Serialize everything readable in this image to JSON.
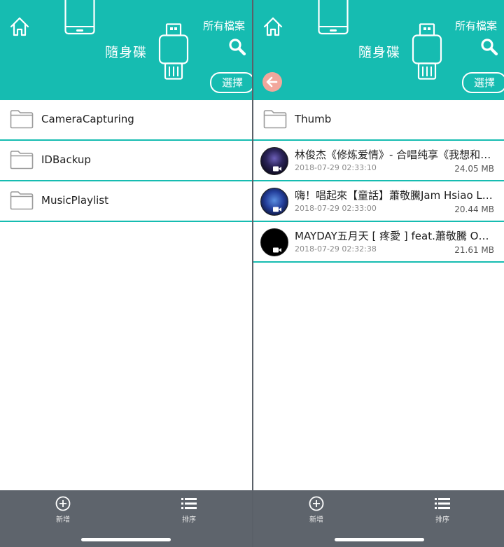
{
  "colors": {
    "header": "#16bcb1",
    "row_divider": "#16bcb1",
    "bottom_bar": "#5e646c",
    "back_button": "#f2a79c"
  },
  "left": {
    "header": {
      "title": "隨身碟",
      "all_files": "所有檔案",
      "select": "選擇",
      "icons": [
        "home-icon",
        "phone-icon",
        "usb-drive-icon",
        "search-icon"
      ]
    },
    "folders": [
      {
        "name": "CameraCapturing",
        "icon": "folder-icon"
      },
      {
        "name": "IDBackup",
        "icon": "folder-icon"
      },
      {
        "name": "MusicPlaylist",
        "icon": "folder-icon"
      }
    ],
    "bottom_bar": {
      "add_label": "新增",
      "sort_label": "排序"
    }
  },
  "right": {
    "header": {
      "title": "隨身碟",
      "all_files": "所有檔案",
      "select": "選擇",
      "icons": [
        "home-icon",
        "phone-icon",
        "usb-drive-icon",
        "search-icon",
        "back-arrow-icon"
      ]
    },
    "folders": [
      {
        "name": "Thumb",
        "icon": "folder-icon"
      }
    ],
    "files": [
      {
        "title": "林俊杰《修炼爱情》- 合唱纯享《我想和你唱》",
        "date": "2018-07-29 02:33:10",
        "size": "24.05 MB",
        "icon": "video-camera-icon"
      },
      {
        "title": "嗨！唱起來【童話】蕭敬騰Jam Hsiao Live",
        "date": "2018-07-29 02:33:00",
        "size": "20.44 MB",
        "icon": "video-camera-icon"
      },
      {
        "title": "MAYDAY五月天 [ 疼愛 ] feat.蕭敬騰 Official",
        "date": "2018-07-29 02:32:38",
        "size": "21.61 MB",
        "icon": "video-camera-icon"
      }
    ],
    "bottom_bar": {
      "add_label": "新增",
      "sort_label": "排序"
    }
  }
}
